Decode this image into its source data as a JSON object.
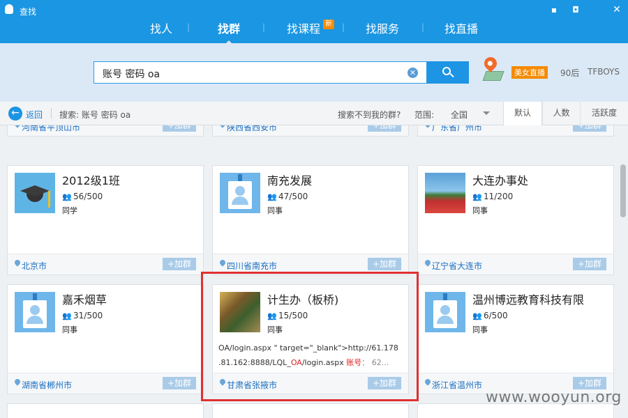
{
  "window": {
    "title": "查找",
    "controls": [
      "feedback-icon",
      "lock-icon",
      "close-icon"
    ]
  },
  "nav": {
    "items": [
      {
        "label": "找人",
        "active": false
      },
      {
        "label": "找群",
        "active": true
      },
      {
        "label": "找课程",
        "active": false,
        "badge": "新"
      },
      {
        "label": "找服务",
        "active": false
      },
      {
        "label": "找直播",
        "active": false
      }
    ],
    "separator": "|"
  },
  "search": {
    "value": "账号 密码 oa",
    "clear_glyph": "✕",
    "hot_tag": "美女直播",
    "links": [
      "90后",
      "TFBOYS"
    ]
  },
  "filter": {
    "back_label": "返回",
    "summary": "搜索: 账号 密码 oa",
    "not_found": "搜索不到我的群?",
    "range_label": "范围:",
    "range_value": "全国",
    "sort_tabs": [
      {
        "label": "默认",
        "active": true
      },
      {
        "label": "人数",
        "active": false
      },
      {
        "label": "活跃度",
        "active": false
      }
    ]
  },
  "join_label": "+加群",
  "top_row_locations": [
    "河南省平顶山市",
    "陕西省西安市",
    "广东省广州市"
  ],
  "groups": [
    {
      "name": "2012级1班",
      "members": "56/500",
      "type": "同学",
      "location": "北京市",
      "avatar": "graduation-cap"
    },
    {
      "name": "南充发展",
      "members": "47/500",
      "type": "同事",
      "location": "四川省南充市",
      "avatar": "id-badge"
    },
    {
      "name": "大连办事处",
      "members": "11/200",
      "type": "同事",
      "location": "辽宁省大连市",
      "avatar": "photo"
    },
    {
      "name": "嘉禾烟草",
      "members": "31/500",
      "type": "同事",
      "location": "湖南省郴州市",
      "avatar": "id-badge"
    },
    {
      "name": "计生办（板桥)",
      "members": "15/500",
      "type": "同事",
      "location": "甘肃省张掖市",
      "avatar": "photo",
      "snippet": {
        "line1": "OA/login.aspx \" target=\"_blank\">http://61.178",
        "line2_a": ".81.162:8888/LQL_",
        "line2_hl": "OA",
        "line2_b": "/login.aspx  ",
        "line2_key": "账号",
        "line2_c": "： 62..."
      }
    },
    {
      "name": "温州博远教育科技有限",
      "members": "6/500",
      "type": "同事",
      "location": "浙江省温州市",
      "avatar": "id-badge"
    }
  ],
  "watermark": "www.wooyun.org"
}
